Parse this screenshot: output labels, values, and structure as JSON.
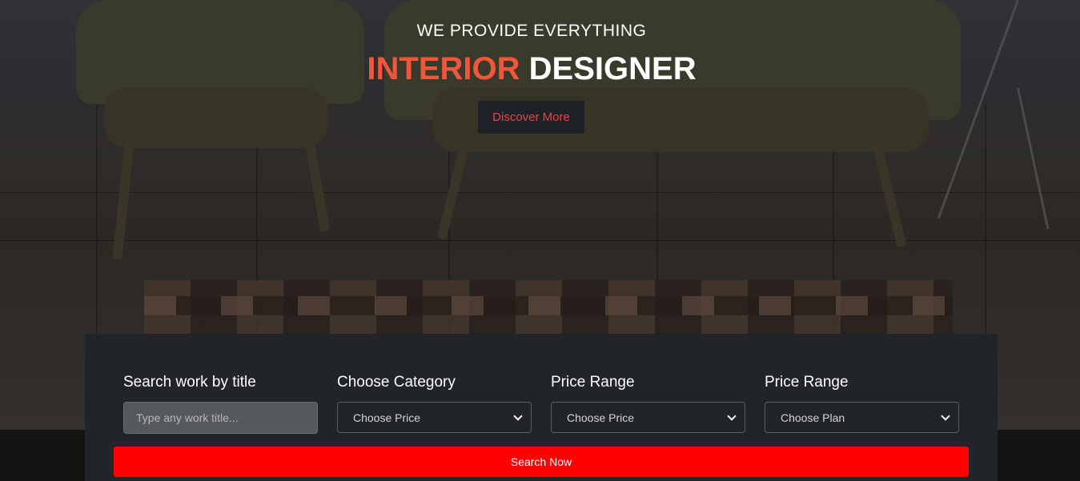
{
  "hero": {
    "tagline": "WE PROVIDE EVERYTHING",
    "headline_accent": "INTERIOR",
    "headline_rest": "DESIGNER",
    "discover_label": "Discover More"
  },
  "search": {
    "title_field": {
      "label": "Search work by title",
      "placeholder": "Type any work title..."
    },
    "category_field": {
      "label": "Choose Category",
      "selected": "Choose Price"
    },
    "price_field": {
      "label": "Price Range",
      "selected": "Choose Price"
    },
    "plan_field": {
      "label": "Price Range",
      "selected": "Choose Plan"
    },
    "submit_label": "Search Now"
  },
  "icons": {
    "select_arrow": "chevron-down-icon"
  },
  "colors": {
    "accent": "#f0573a",
    "button_red": "#ff0000",
    "discover_text": "#e8414f",
    "panel_bg": "#212429"
  }
}
